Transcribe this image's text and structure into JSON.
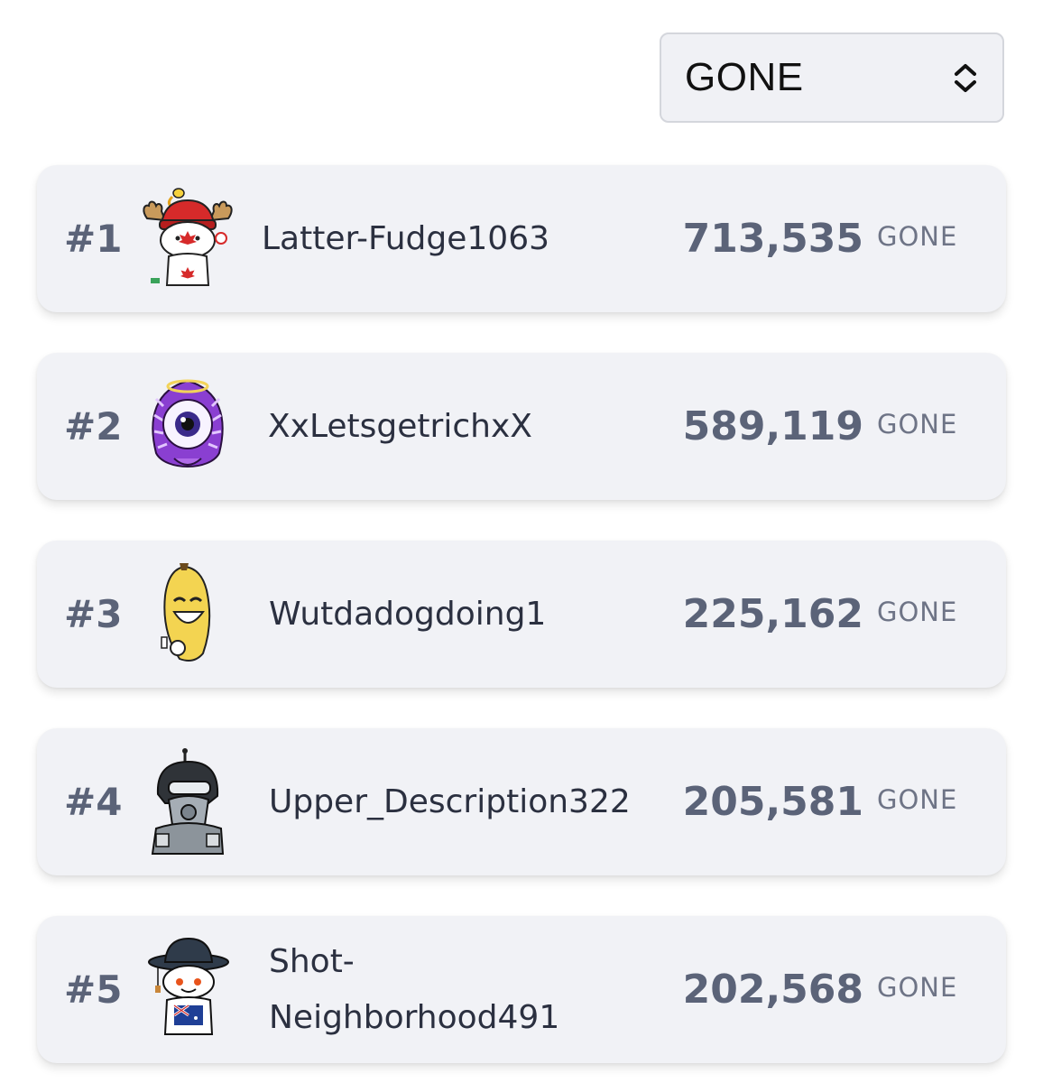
{
  "token_selector": {
    "selected": "GONE",
    "icon": "chevron-updown-icon"
  },
  "leaderboard": [
    {
      "rank": "#1",
      "username": "Latter-Fudge1063",
      "amount": "713,535",
      "unit": "GONE",
      "avatar": "moose-canada-avatar"
    },
    {
      "rank": "#2",
      "username": "XxLetsgetrichxX",
      "amount": "589,119",
      "unit": "GONE",
      "avatar": "purple-eye-avatar"
    },
    {
      "rank": "#3",
      "username": "Wutdadogdoing1",
      "amount": "225,162",
      "unit": "GONE",
      "avatar": "banana-avatar"
    },
    {
      "rank": "#4",
      "username": "Upper_Description322",
      "amount": "205,581",
      "unit": "GONE",
      "avatar": "hooded-robot-avatar"
    },
    {
      "rank": "#5",
      "username": "Shot-\nNeighborhood491",
      "amount": "202,568",
      "unit": "GONE",
      "avatar": "australia-hat-avatar"
    }
  ],
  "colors": {
    "card_bg": "#f1f2f6",
    "rank_text": "#5b6378",
    "username_text": "#2b3040",
    "unit_text": "#6e7486"
  }
}
